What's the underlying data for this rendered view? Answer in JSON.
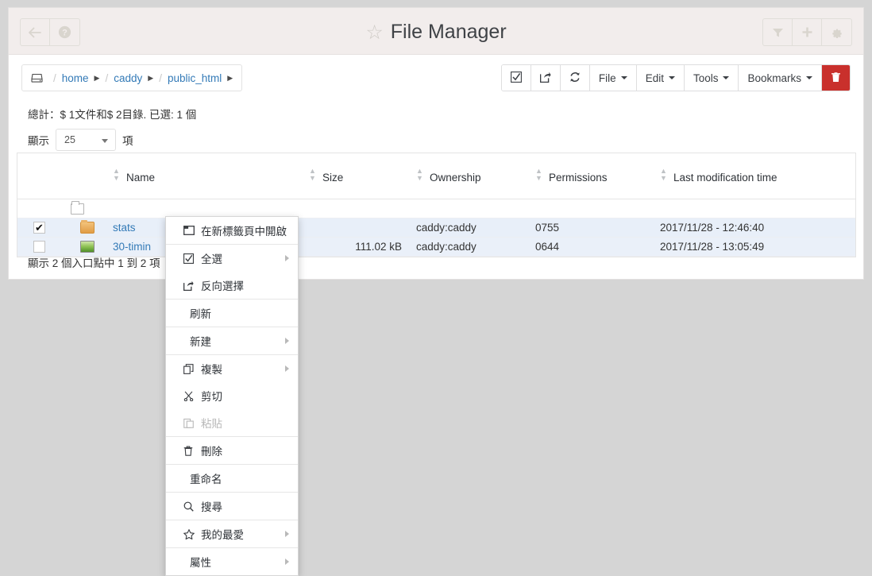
{
  "header": {
    "title": "File Manager",
    "star_icon": "star-outline-icon",
    "left_buttons": [
      {
        "name": "back-button",
        "icon": "arrow-left-icon"
      },
      {
        "name": "help-button",
        "icon": "question-circle-icon"
      }
    ],
    "right_buttons": [
      {
        "name": "filter-button",
        "icon": "filter-icon"
      },
      {
        "name": "add-button",
        "icon": "plus-icon"
      },
      {
        "name": "settings-button",
        "icon": "gear-icon"
      }
    ]
  },
  "breadcrumb": {
    "drive_icon": "hdd-icon",
    "separator": "/",
    "items": [
      {
        "label": "home"
      },
      {
        "label": "caddy"
      },
      {
        "label": "public_html"
      }
    ]
  },
  "toolbar": {
    "buttons": [
      {
        "name": "select-all-button",
        "icon": "check-square-icon",
        "label": ""
      },
      {
        "name": "invert-selection-button",
        "icon": "share-square-icon",
        "label": ""
      },
      {
        "name": "refresh-button",
        "icon": "refresh-icon",
        "label": ""
      },
      {
        "name": "file-menu",
        "label": "File",
        "caret": true
      },
      {
        "name": "edit-menu",
        "label": "Edit",
        "caret": true
      },
      {
        "name": "tools-menu",
        "label": "Tools",
        "caret": true
      },
      {
        "name": "bookmarks-menu",
        "label": "Bookmarks",
        "caret": true
      },
      {
        "name": "delete-button",
        "icon": "trash-icon",
        "label": "",
        "danger": true
      }
    ],
    "danger_color": "#c9302c"
  },
  "status": {
    "summary": "總計：$ 1文件和$ 2目錄. 已選: 1 個",
    "show_label": "顯示",
    "page_size": "25",
    "items_label": "項"
  },
  "table": {
    "columns": [
      {
        "key": "name",
        "label": "Name"
      },
      {
        "key": "size",
        "label": "Size"
      },
      {
        "key": "ownership",
        "label": "Ownership"
      },
      {
        "key": "permissions",
        "label": "Permissions"
      },
      {
        "key": "modified",
        "label": "Last modification time"
      }
    ],
    "parent_row": {
      "name": "..",
      "icon": "folder-open-outline-icon"
    },
    "rows": [
      {
        "checked": true,
        "icon": "folder-icon",
        "name": "stats",
        "size": "",
        "ownership": "caddy:caddy",
        "permissions": "0755",
        "modified": "2017/11/28 - 12:46:40"
      },
      {
        "checked": false,
        "icon": "image-file-icon",
        "name": "30-timin",
        "size": "111.02 kB",
        "ownership": "caddy:caddy",
        "permissions": "0644",
        "modified": "2017/11/28 - 13:05:49"
      }
    ]
  },
  "footer": {
    "text": "顯示 2 個入口點中 1 到 2 項"
  },
  "context_menu": {
    "items": [
      {
        "label": "在新標籤頁中開啟",
        "icon": "new-tab-icon",
        "submenu": false,
        "disabled": false,
        "separator_after": true
      },
      {
        "label": "全選",
        "icon": "check-square-icon",
        "submenu": true,
        "disabled": false,
        "separator_after": false
      },
      {
        "label": "反向選擇",
        "icon": "share-square-icon",
        "submenu": false,
        "disabled": false,
        "separator_after": true
      },
      {
        "label": "刷新",
        "icon": "",
        "submenu": false,
        "disabled": false,
        "separator_after": true
      },
      {
        "label": "新建",
        "icon": "",
        "submenu": true,
        "disabled": false,
        "separator_after": true
      },
      {
        "label": "複製",
        "icon": "copy-icon",
        "submenu": true,
        "disabled": false,
        "separator_after": false
      },
      {
        "label": "剪切",
        "icon": "scissors-icon",
        "submenu": false,
        "disabled": false,
        "separator_after": false
      },
      {
        "label": "粘貼",
        "icon": "paste-icon",
        "submenu": false,
        "disabled": true,
        "separator_after": true
      },
      {
        "label": "刪除",
        "icon": "trash-icon",
        "submenu": false,
        "disabled": false,
        "separator_after": true
      },
      {
        "label": "重命名",
        "icon": "",
        "submenu": false,
        "disabled": false,
        "separator_after": true
      },
      {
        "label": "搜尋",
        "icon": "search-icon",
        "submenu": false,
        "disabled": false,
        "separator_after": true
      },
      {
        "label": "我的最愛",
        "icon": "star-outline-icon",
        "submenu": true,
        "disabled": false,
        "separator_after": true
      },
      {
        "label": "屬性",
        "icon": "",
        "submenu": true,
        "disabled": false,
        "separator_after": false
      }
    ]
  },
  "colors": {
    "page_bg": "#d5d5d5",
    "header_bg": "#f2edec",
    "link": "#337ab7",
    "selected_row": "#e8eff9"
  }
}
